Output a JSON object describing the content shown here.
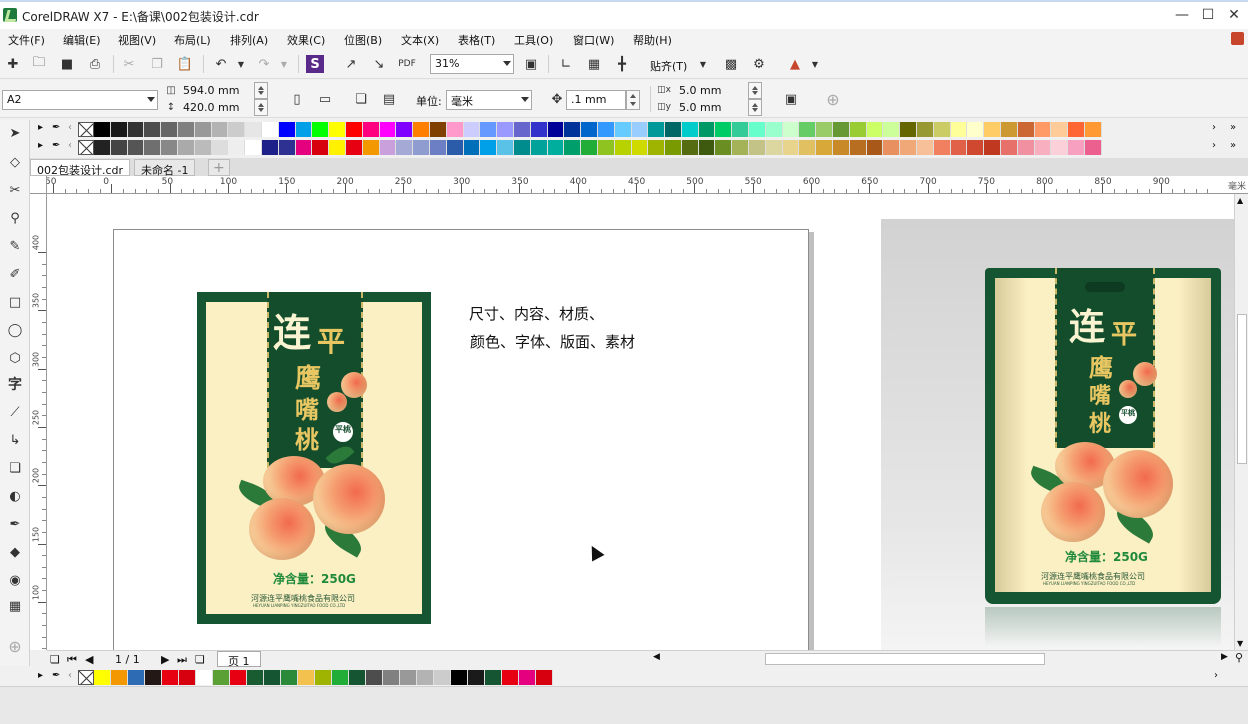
{
  "window": {
    "title": "CorelDRAW X7 - E:\\备课\\002包装设计.cdr"
  },
  "menu": [
    "文件(F)",
    "编辑(E)",
    "视图(V)",
    "布局(L)",
    "排列(A)",
    "效果(C)",
    "位图(B)",
    "文本(X)",
    "表格(T)",
    "工具(O)",
    "窗口(W)",
    "帮助(H)"
  ],
  "toolbar": {
    "zoom": "31%",
    "snap_label": "贴齐(T)"
  },
  "propertybar": {
    "page_size": "A2",
    "width": "594.0 mm",
    "height": "420.0 mm",
    "units_label": "单位:",
    "units": "毫米",
    "nudge": ".1 mm",
    "dup_x": "5.0 mm",
    "dup_y": "5.0 mm"
  },
  "tabs": [
    "002包装设计.cdr",
    "未命名 -1"
  ],
  "ruler": {
    "h_labels": [
      "50",
      "0",
      "50",
      "100",
      "150",
      "200",
      "250",
      "300",
      "350",
      "400",
      "450",
      "500",
      "550",
      "600",
      "650",
      "700",
      "750",
      "800",
      "850",
      "900"
    ],
    "v_labels": [
      "400",
      "350",
      "300",
      "250",
      "200",
      "150",
      "100"
    ],
    "unit": "毫米"
  },
  "canvas": {
    "note_line1": "尺寸、内容、材质、",
    "note_line2": "颜色、字体、版面、素材"
  },
  "package": {
    "brand_1": "连",
    "brand_2": "平",
    "brand_3": "鹰",
    "brand_4": "嘴",
    "brand_5": "桃",
    "seal": "平桃",
    "net_weight": "净含量：250G",
    "company": "河源连平鹰嘴桃食品有限公司",
    "company_en": "HEYUAN LIANPING YINGZUITAO FOOD CO.,LTD"
  },
  "pagenav": {
    "count": "1 / 1",
    "page_tab": "页 1"
  },
  "colors": {
    "package_green": "#155532",
    "package_cream": "#fbefc4",
    "gold": "#e8c763"
  },
  "palette_row1": [
    "#000000",
    "#1a1a1a",
    "#333333",
    "#4d4d4d",
    "#666666",
    "#808080",
    "#999999",
    "#b3b3b3",
    "#cccccc",
    "#e6e6e6",
    "#ffffff",
    "#0000ff",
    "#00a0e9",
    "#00ff00",
    "#ffff00",
    "#ff0000",
    "#ff0080",
    "#ff00ff",
    "#8000ff",
    "#ff8000",
    "#804000",
    "#ff99cc",
    "#ccccff",
    "#6699ff",
    "#9999ff",
    "#6666cc",
    "#3333cc",
    "#000099",
    "#003399",
    "#0066cc",
    "#3399ff",
    "#66ccff",
    "#99ccff",
    "#009999",
    "#006666",
    "#00cccc",
    "#009966",
    "#00cc66",
    "#33cc99",
    "#66ffcc",
    "#99ffcc",
    "#ccffcc",
    "#66cc66",
    "#99cc66",
    "#669933",
    "#99cc33",
    "#ccff66",
    "#ccff99",
    "#666600",
    "#999933",
    "#cccc66",
    "#ffff99",
    "#ffffcc",
    "#ffcc66",
    "#cc9933",
    "#cc6633",
    "#ff9966",
    "#ffcc99",
    "#ff6633",
    "#ff9933"
  ],
  "palette_row2": [
    "#222222",
    "#444444",
    "#555555",
    "#6f6f6f",
    "#888888",
    "#aaaaaa",
    "#bbbbbb",
    "#dddddd",
    "#eeeeee",
    "#ffffff",
    "#1d2088",
    "#2e3192",
    "#e4007f",
    "#d7000f",
    "#fff100",
    "#e60012",
    "#f39800",
    "#c9a0dc",
    "#a5a9d6",
    "#8e9cd0",
    "#6c7fc4",
    "#2a5caa",
    "#006fba",
    "#00a0e9",
    "#5bc2e7",
    "#008c8c",
    "#00a29a",
    "#00ae9d",
    "#009e6b",
    "#22ac38",
    "#8fc31f",
    "#b8d200",
    "#cfdb00",
    "#9eb400",
    "#7a9a01",
    "#566c11",
    "#3d5a0f",
    "#6b8e23",
    "#a4b357",
    "#c3c388",
    "#dcd6a0",
    "#e8d48c",
    "#e0c060",
    "#d8a838",
    "#c88a28",
    "#b86e20",
    "#a85818",
    "#e89060",
    "#f0a878",
    "#f8c098",
    "#f08060",
    "#e06048",
    "#d04830",
    "#c03820",
    "#e8706a",
    "#f090a0",
    "#f8b0c0",
    "#fcd0d8",
    "#f8a0c0",
    "#ec6090"
  ],
  "palette_bottom": [
    "#ffff00",
    "#f39800",
    "#2e6bb5",
    "#231815",
    "#e60012",
    "#d7000f",
    "#ffffff",
    "#5aa035",
    "#e60012",
    "#1a5c32",
    "#155532",
    "#2a8a3a",
    "#f2c14e",
    "#9eb400",
    "#22ac38",
    "#155532",
    "#4d4d4d",
    "#808080",
    "#999999",
    "#b3b3b3",
    "#cccccc",
    "#000000",
    "#1a1a1a",
    "#155532",
    "#e60012",
    "#e4007f",
    "#d7000f"
  ]
}
